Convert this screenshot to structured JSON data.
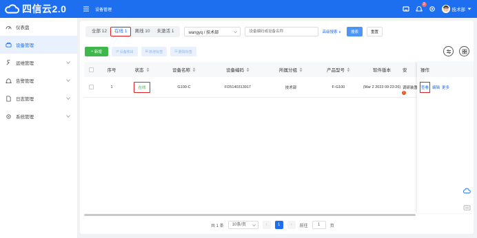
{
  "header": {
    "logo_text": "四信云2.0",
    "title": "设备管理",
    "notification_count": "3",
    "user": "技术部",
    "accent": "#1e6ff0"
  },
  "sidebar": {
    "items": [
      {
        "label": "仪表盘",
        "icon": "dashboard-icon"
      },
      {
        "label": "设备管理",
        "icon": "device-icon"
      },
      {
        "label": "运维管理",
        "icon": "ops-icon"
      },
      {
        "label": "告警管理",
        "icon": "alarm-icon"
      },
      {
        "label": "日志管理",
        "icon": "log-icon"
      },
      {
        "label": "系统管理",
        "icon": "system-icon"
      }
    ]
  },
  "filter": {
    "tabs": [
      "全部 12",
      "在线 1",
      "离线 10",
      "未激活 1"
    ],
    "group_select": "wangyq / 技术部",
    "search_placeholder": "设备编码或设备名称",
    "advanced_label": "高级搜索",
    "search_button": "搜索",
    "reset_button": "重置"
  },
  "toolbar": {
    "add_label": "新增",
    "move_label": "设备移出",
    "add_tag_label": "新增标签",
    "delete_tag_label": "删除标签"
  },
  "table": {
    "columns": [
      "序号",
      "状态",
      "设备名称",
      "设备编码",
      "所属分组",
      "产品型号",
      "软件版本",
      "安"
    ],
    "rows": [
      {
        "no": "1",
        "status": "在线",
        "name": "G100-C",
        "code": "FD5140313917",
        "group": "技术部",
        "model": "F-G100",
        "software": "(Mar 2 2023 09:23:26)",
        "install": "调研装置",
        "warn": "!"
      }
    ],
    "op_header": "操作",
    "op_view": "查看",
    "op_edit": "编辑",
    "op_more": "更多"
  },
  "pagination": {
    "total": "共 1 条",
    "page_size": "10条/页",
    "current_page": "1",
    "goto_label": "前往",
    "goto_value": "1",
    "page_suffix": "页"
  }
}
